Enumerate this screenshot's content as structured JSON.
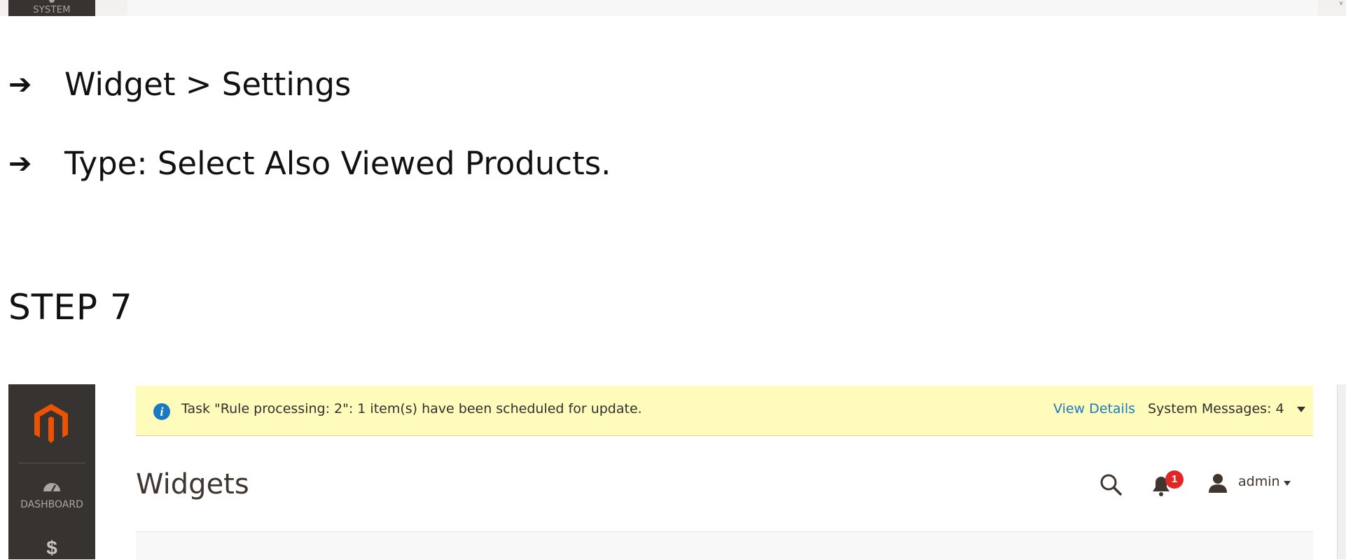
{
  "top_strip": {
    "sidebar_label": "SYSTEM"
  },
  "instructions": {
    "arrow_glyph": "➔",
    "line1": "Widget > Settings",
    "line2": "Type: Select Also Viewed Products.",
    "step_heading": "STEP 7"
  },
  "admin": {
    "brand_color": "#eb5202",
    "sidebar": {
      "items": [
        {
          "label": "DASHBOARD",
          "icon": "dashboard-gauge-icon"
        },
        {
          "label": "$",
          "icon": "sales-dollar-icon"
        }
      ]
    },
    "notice": {
      "text": "Task \"Rule processing: 2\": 1 item(s) have been scheduled for update.",
      "link": "View Details",
      "system_messages": "System Messages: 4",
      "background": "#fffbbb"
    },
    "header": {
      "title": "Widgets",
      "notifications_count": "1",
      "user": "admin"
    }
  }
}
